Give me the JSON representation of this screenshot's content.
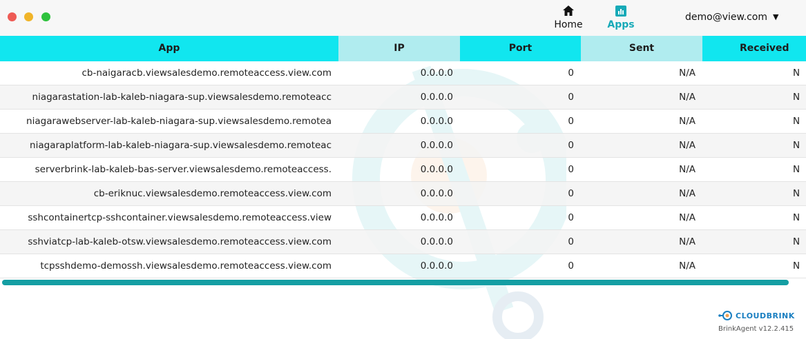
{
  "window": {
    "controls": [
      "close",
      "minimize",
      "maximize"
    ]
  },
  "nav": {
    "home_label": "Home",
    "apps_label": "Apps",
    "user": "demo@view.com"
  },
  "table": {
    "columns": [
      "App",
      "IP",
      "Port",
      "Sent",
      "Received"
    ],
    "rows": [
      {
        "app": "cb-naigaracb.viewsalesdemo.remoteaccess.view.com",
        "ip": "0.0.0.0",
        "port": "0",
        "sent": "N/A",
        "received": "N"
      },
      {
        "app": "niagarastation-lab-kaleb-niagara-sup.viewsalesdemo.remoteacc",
        "ip": "0.0.0.0",
        "port": "0",
        "sent": "N/A",
        "received": "N"
      },
      {
        "app": "niagarawebserver-lab-kaleb-niagara-sup.viewsalesdemo.remotea",
        "ip": "0.0.0.0",
        "port": "0",
        "sent": "N/A",
        "received": "N"
      },
      {
        "app": "niagaraplatform-lab-kaleb-niagara-sup.viewsalesdemo.remoteac",
        "ip": "0.0.0.0",
        "port": "0",
        "sent": "N/A",
        "received": "N"
      },
      {
        "app": "serverbrink-lab-kaleb-bas-server.viewsalesdemo.remoteaccess.",
        "ip": "0.0.0.0",
        "port": "0",
        "sent": "N/A",
        "received": "N"
      },
      {
        "app": "cb-eriknuc.viewsalesdemo.remoteaccess.view.com",
        "ip": "0.0.0.0",
        "port": "0",
        "sent": "N/A",
        "received": "N"
      },
      {
        "app": "sshcontainertcp-sshcontainer.viewsalesdemo.remoteaccess.view",
        "ip": "0.0.0.0",
        "port": "0",
        "sent": "N/A",
        "received": "N"
      },
      {
        "app": "sshviatcp-lab-kaleb-otsw.viewsalesdemo.remoteaccess.view.com",
        "ip": "0.0.0.0",
        "port": "0",
        "sent": "N/A",
        "received": "N"
      },
      {
        "app": "tcpsshdemo-demossh.viewsalesdemo.remoteaccess.view.com",
        "ip": "0.0.0.0",
        "port": "0",
        "sent": "N/A",
        "received": "N"
      }
    ]
  },
  "footer": {
    "brand": "CLOUDBRINK",
    "version": "BrinkAgent v12.2.415"
  },
  "colors": {
    "header_primary": "#11e6ef",
    "header_secondary": "#b0ecef",
    "accent": "#17aab8",
    "scrollbar": "#149ea3"
  }
}
